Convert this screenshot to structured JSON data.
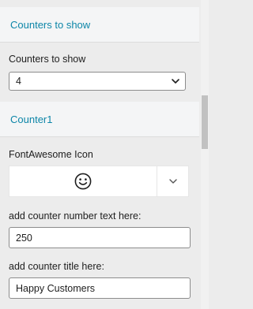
{
  "sections": {
    "counters": {
      "title": "Counters to show",
      "select": {
        "label": "Counters to show",
        "value": "4"
      }
    },
    "counter1": {
      "title": "Counter1",
      "icon_field": {
        "label": "FontAwesome Icon",
        "icon": "smile-icon",
        "toggle_icon": "chevron-down-icon"
      },
      "number_field": {
        "label": "add counter number text here:",
        "value": "250"
      },
      "title_field": {
        "label": "add counter title here:",
        "value": "Happy Customers"
      }
    }
  },
  "colors": {
    "accent": "#0d86a8",
    "panel_bg": "#ececec",
    "header_bg": "#f4f5f6"
  }
}
